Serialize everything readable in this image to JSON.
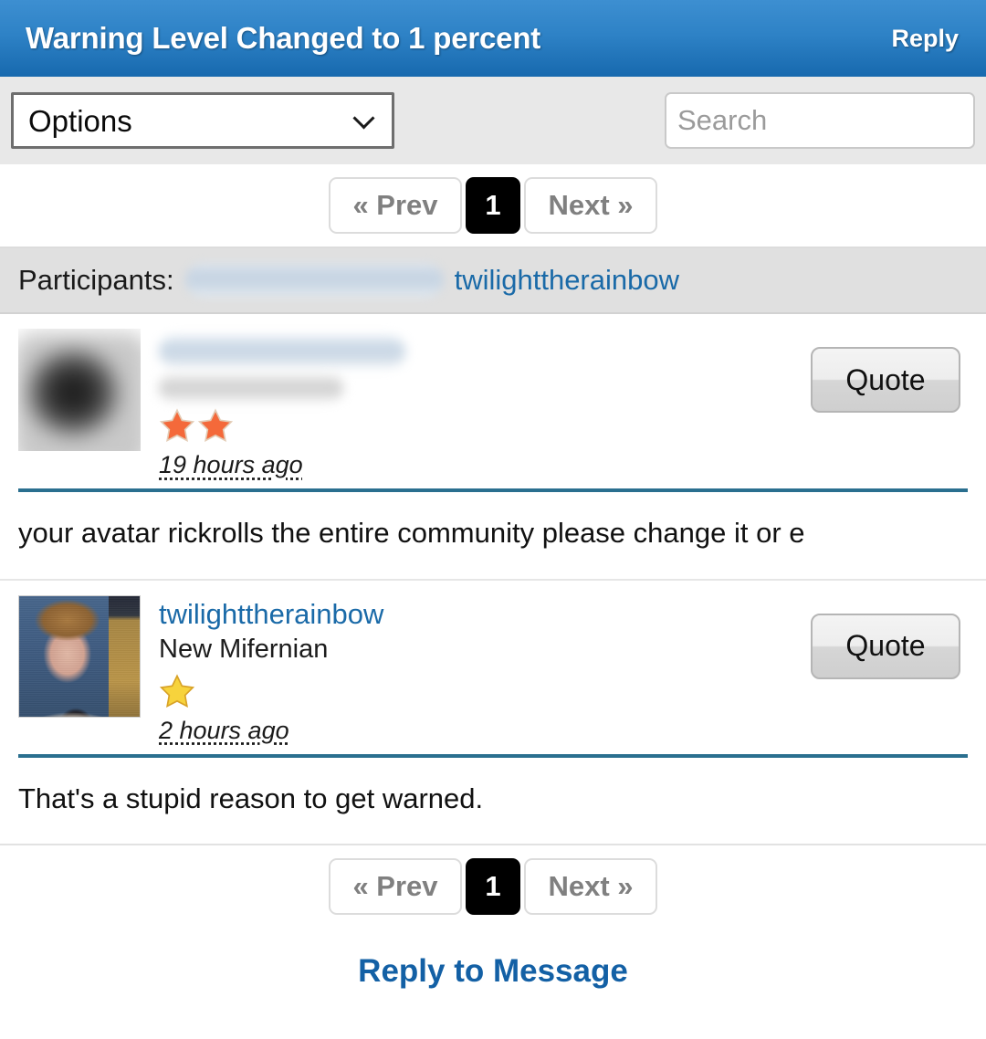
{
  "header": {
    "title": "Warning Level Changed to 1 percent",
    "reply_label": "Reply",
    "bg_color": "#2e82c6",
    "text_color": "#ffffff"
  },
  "toolbar": {
    "options_label": "Options",
    "options_selected": "Options",
    "options_icon": "chevron-down-icon",
    "search_placeholder": "Search",
    "search_value": "",
    "search_icon": "search-icon"
  },
  "pagination": {
    "prev_label": "« Prev",
    "current_page": "1",
    "next_label": "Next »",
    "current_bg": "#000000",
    "current_text": "#ffffff",
    "button_text_color": "#808080"
  },
  "participants": {
    "label": "Participants:",
    "redacted_name": "",
    "named": "twilighttherainbow",
    "link_color": "#1a6aa8",
    "bg_color": "#e0e0e0"
  },
  "posts": [
    {
      "username": "",
      "username_redacted": true,
      "rank": "",
      "rank_redacted": true,
      "avatar": "blurred-avatar",
      "stars": 2,
      "star_color": "#f4693a",
      "timestamp": "19 hours ago",
      "quote_label": "Quote",
      "body": "your avatar rickrolls the entire community please change it or e",
      "rule_color": "#2a6f8f"
    },
    {
      "username": "twilighttherainbow",
      "username_redacted": false,
      "rank": "New Mifernian",
      "rank_redacted": false,
      "avatar": "rickroll-avatar",
      "stars": 1,
      "star_color": "#f7d33c",
      "timestamp": "2 hours ago",
      "quote_label": "Quote",
      "body": "That's a stupid reason to get warned.",
      "rule_color": "#2a6f8f"
    }
  ],
  "footer": {
    "reply_to_message": "Reply to Message",
    "link_color": "#1360a5"
  }
}
